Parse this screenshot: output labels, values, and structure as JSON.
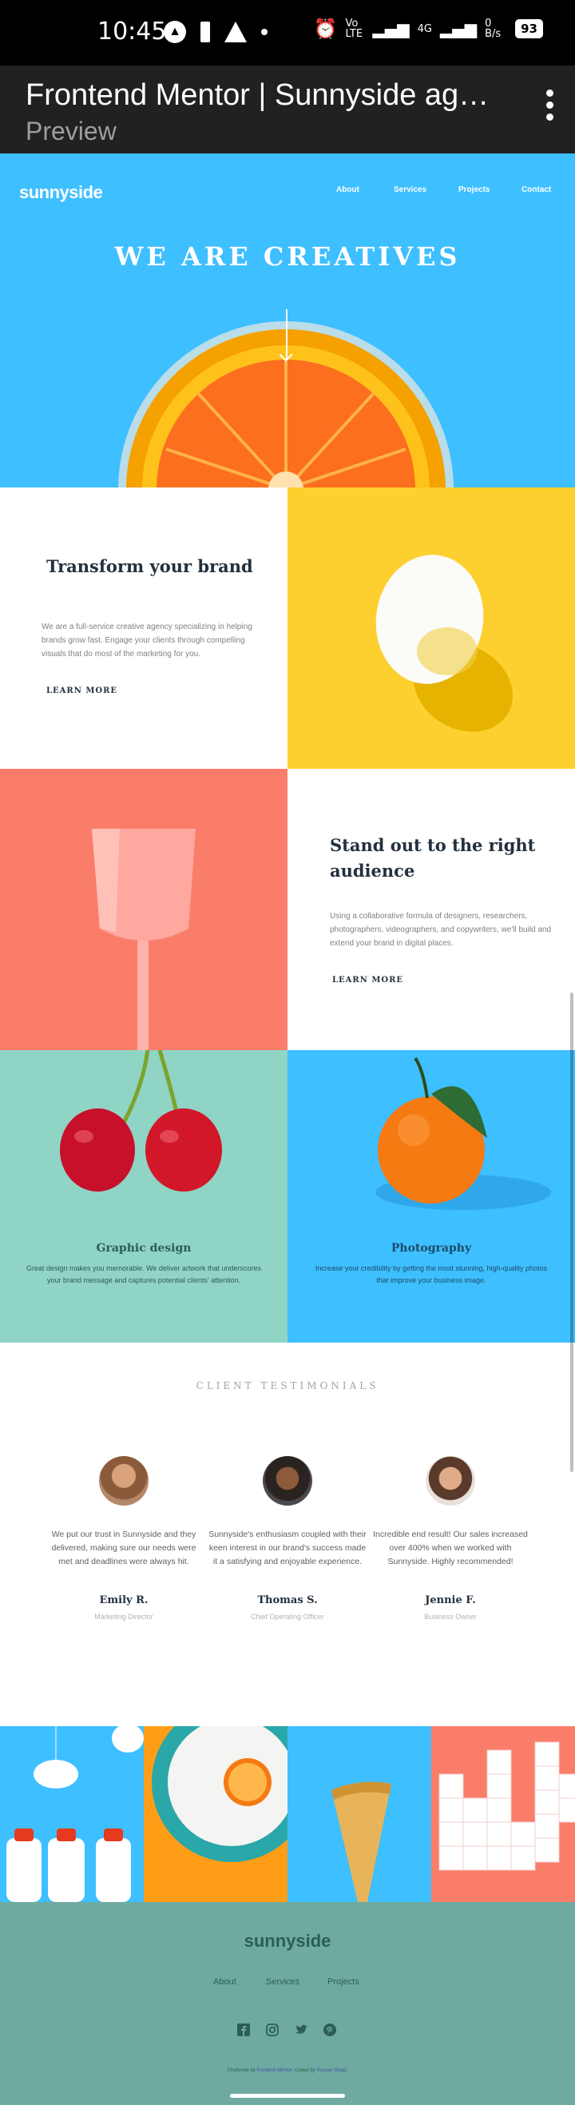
{
  "status_bar": {
    "time": "10:45",
    "network": "Vo LTE",
    "signal": "4G",
    "data_rate": "0 B/s",
    "battery": "93"
  },
  "browser": {
    "title": "Frontend Mentor | Sunnyside ag…",
    "subtitle": "Preview"
  },
  "site": {
    "logo": "sunnyside",
    "nav": [
      "About",
      "Services",
      "Projects",
      "Contact"
    ],
    "hero_title": "WE ARE CREATIVES",
    "features": [
      {
        "title": "Transform your brand",
        "text": "We are a full-service creative agency specializing in helping brands grow fast. Engage your clients through compelling visuals that do most of the marketing for you.",
        "cta": "LEARN MORE"
      },
      {
        "title": "Stand out to the right audience",
        "text": "Using a collaborative formula of designers, researchers, photographers, videographers, and copywriters, we'll build and extend your brand in digital places.",
        "cta": "LEARN MORE"
      }
    ],
    "services": [
      {
        "title": "Graphic design",
        "text": "Great design makes you memorable. We deliver artwork that underscores your brand message and captures potential clients' attention."
      },
      {
        "title": "Photography",
        "text": "Increase your credibility by getting the most stunning, high-quality photos that improve your business image."
      }
    ],
    "testimonials_title": "CLIENT TESTIMONIALS",
    "testimonials": [
      {
        "quote": "We put our trust in Sunnyside and they delivered, making sure our needs were met and deadlines were always hit.",
        "name": "Emily R.",
        "role": "Marketing Director"
      },
      {
        "quote": "Sunnyside's enthusiasm coupled with their keen interest in our brand's success made it a satisfying and enjoyable experience.",
        "name": "Thomas S.",
        "role": "Chief Operating Officer"
      },
      {
        "quote": "Incredible end result! Our sales increased over 400% when we worked with Sunnyside. Highly recommended!",
        "name": "Jennie F.",
        "role": "Business Owner"
      }
    ],
    "footer": {
      "logo": "sunnyside",
      "nav": [
        "About",
        "Services",
        "Projects"
      ],
      "social": [
        "facebook-icon",
        "instagram-icon",
        "twitter-icon",
        "pinterest-icon"
      ],
      "credit_prefix": "Challenge by",
      "credit_link1": "Frontend Mentor",
      "credit_mid": "Coded by",
      "credit_link2": "Hassan Shaiq"
    },
    "colors": {
      "hero_blue": "#3ebfff",
      "yellow": "#fdd244",
      "coral": "#fa7d6a",
      "mint": "#90d4c5",
      "footer_green": "#6eaaa0"
    }
  }
}
